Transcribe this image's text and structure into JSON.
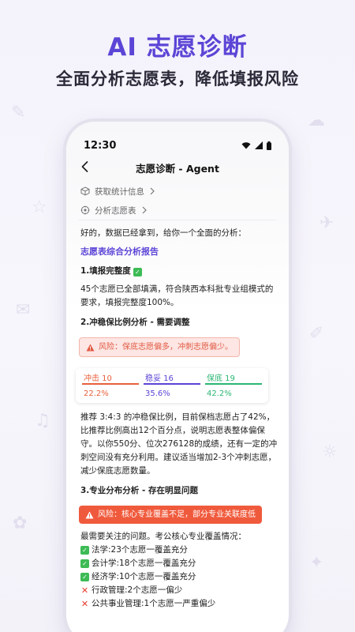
{
  "hero": {
    "title": "AI 志愿诊断",
    "subtitle": "全面分析志愿表，降低填报风险"
  },
  "status_bar": {
    "time": "12:30"
  },
  "nav": {
    "title": "志愿诊断 - Agent"
  },
  "steps": [
    {
      "label": "获取统计信息",
      "icon": "cube-icon"
    },
    {
      "label": "分析志愿表",
      "icon": "analysis-icon"
    }
  ],
  "intro": "好的，数据已经拿到，给你一个全面的分析：",
  "report_title": "志愿表综合分析报告",
  "section1": {
    "title": "1.填报完整度",
    "body": "45个志愿已全部填满，符合陕西本科批专业组模式的要求，填报完整度100%。"
  },
  "section2": {
    "title": "2.冲稳保比例分析 - 需要调整",
    "risk": "风险：保底志愿偏多，冲刺志愿偏少。",
    "ratio": [
      {
        "label": "冲击 10",
        "percent": "22.2%",
        "color": "#e8603c"
      },
      {
        "label": "稳妥 16",
        "percent": "35.6%",
        "color": "#5b45d6"
      },
      {
        "label": "保底 19",
        "percent": "42.2%",
        "color": "#2bb673"
      }
    ],
    "body": "推荐 3:4:3 的冲稳保比例，目前保档志愿占了42%，比推荐比例高出12个百分点，说明志愿表整体偏保守。以你550分、位次276128的成绩，还有一定的冲刺空间没有充分利用。建议适当增加2-3个冲刺志愿，减少保底志愿数量。"
  },
  "section3": {
    "title": "3.专业分布分析 - 存在明显问题",
    "risk": "风险：核心专业覆盖不足，部分专业关联度低",
    "intro": "最需要关注的问题。考公核心专业覆盖情况：",
    "items": [
      {
        "text": "法学:23个志愿一覆盖充分",
        "status": "ok"
      },
      {
        "text": "会计学:18个志愿一覆盖充分",
        "status": "ok"
      },
      {
        "text": "经济学:10个志愿一覆盖充分",
        "status": "ok"
      },
      {
        "text": "行政管理:2个志愿一偏少",
        "status": "bad"
      },
      {
        "text": "公共事业管理:1个志愿一严重偏少",
        "status": "bad"
      }
    ]
  },
  "colors": {
    "accent": "#5b45d6",
    "risk": "#f05a3c",
    "ok": "#3dbb55"
  }
}
